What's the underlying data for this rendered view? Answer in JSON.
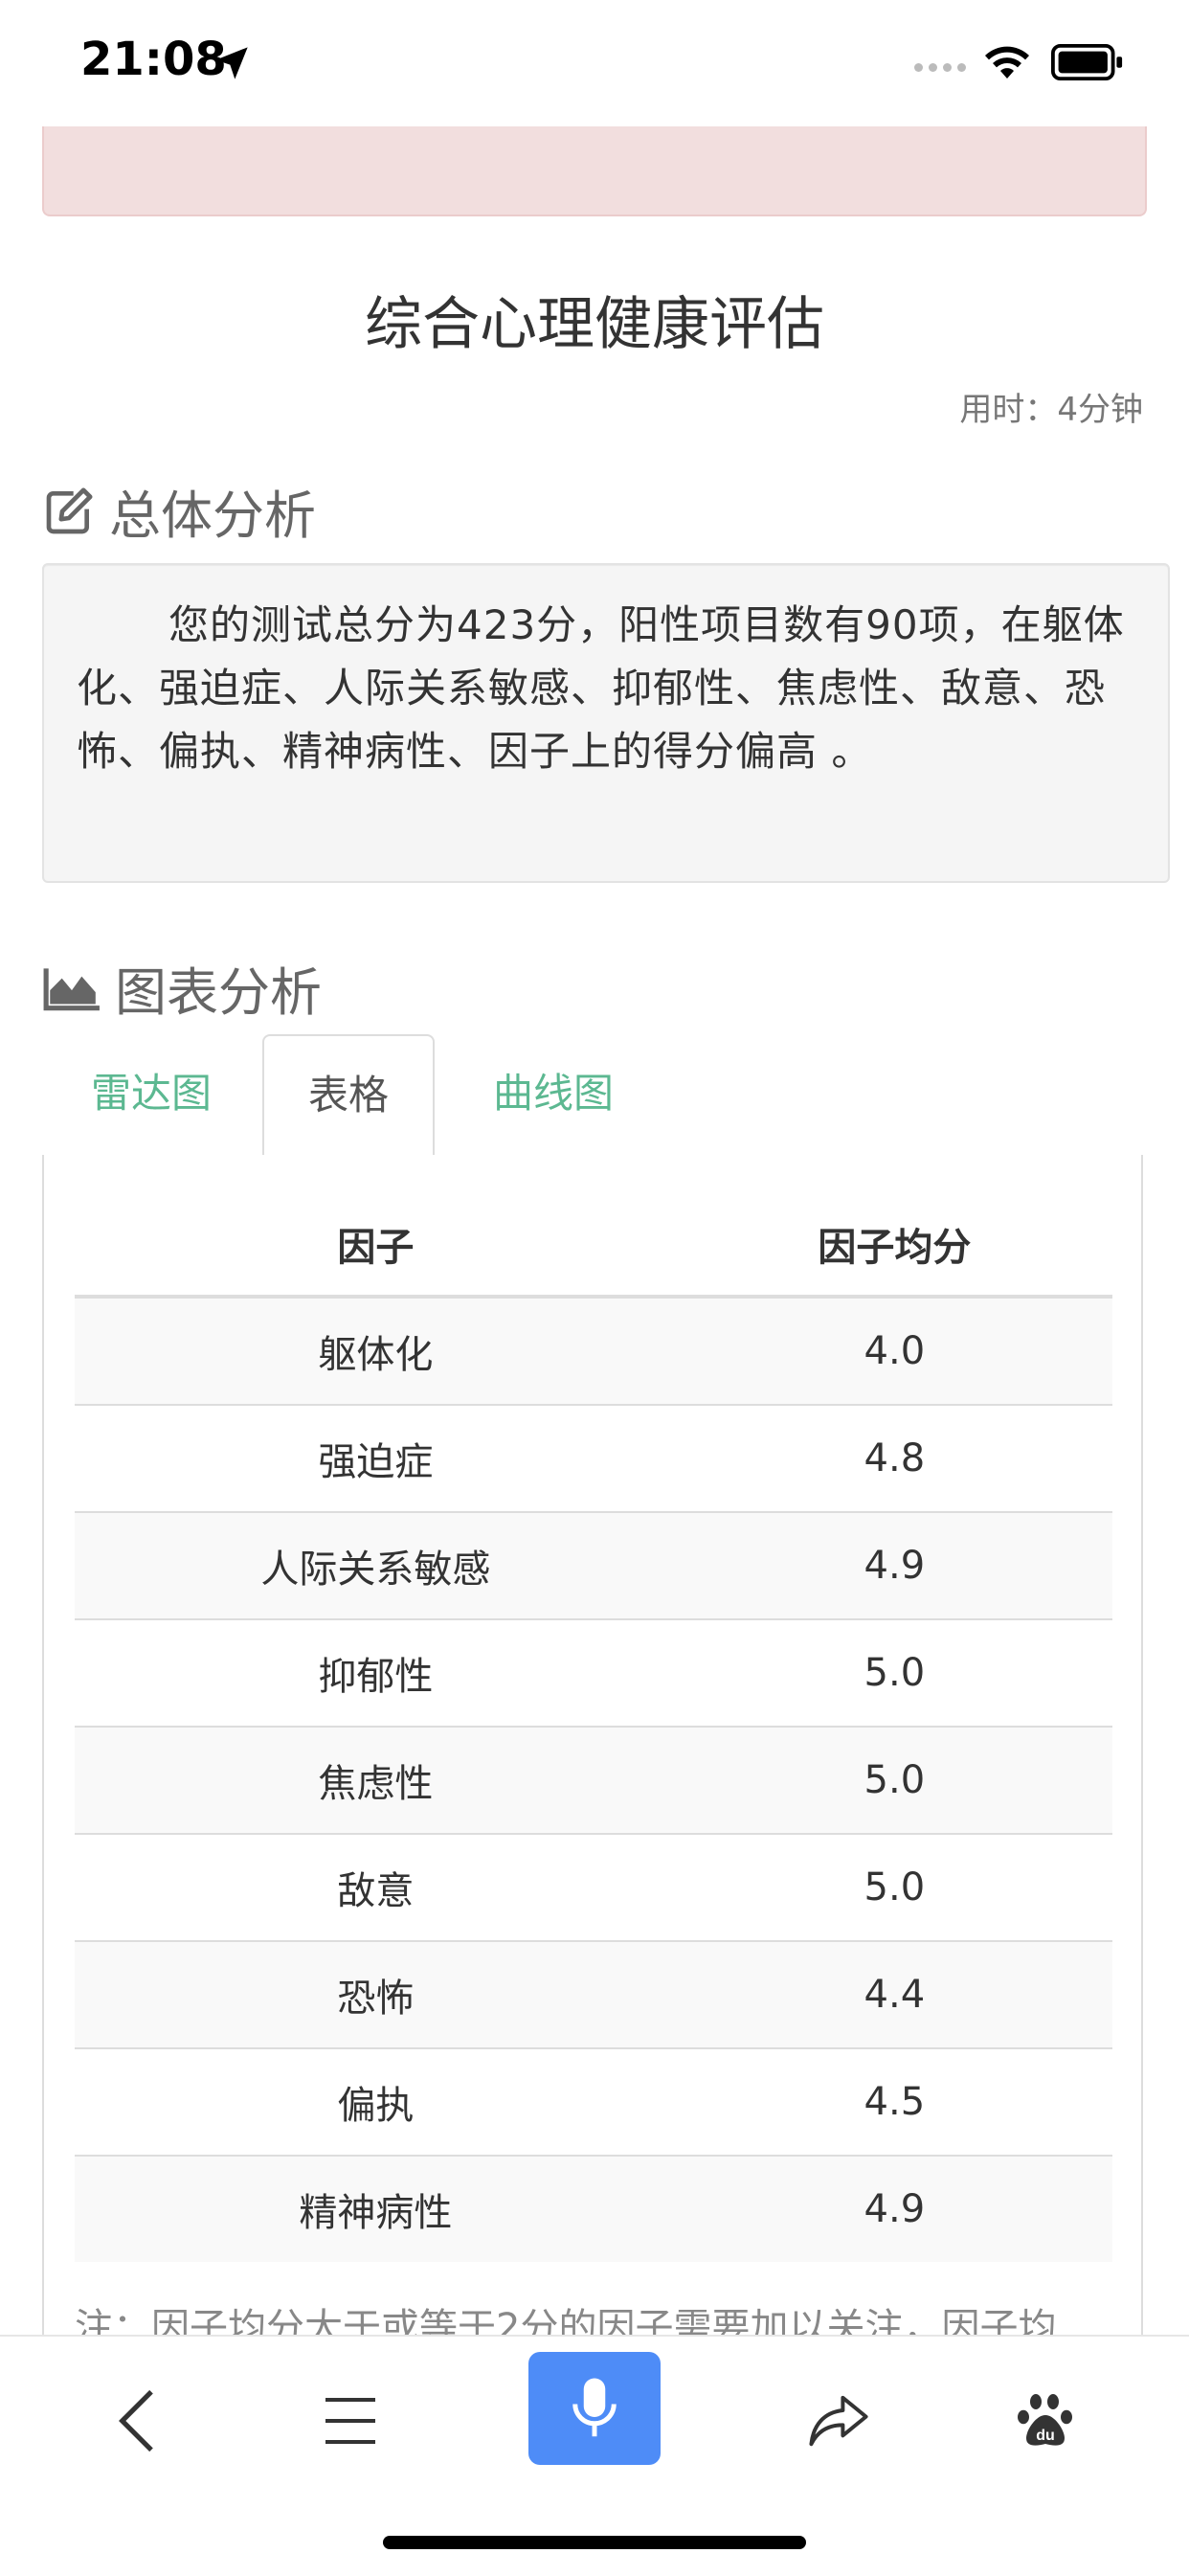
{
  "status_bar": {
    "time": "21:08"
  },
  "page": {
    "title": "综合心理健康评估",
    "duration": "用时：4分钟"
  },
  "overall": {
    "heading": "总体分析",
    "summary": "您的测试总分为423分，阳性项目数有90项，在躯体化、强迫症、人际关系敏感、抑郁性、焦虑性、敌意、恐怖、偏执、精神病性、因子上的得分偏高 。"
  },
  "chart_section": {
    "heading": "图表分析",
    "tabs": [
      {
        "label": "雷达图",
        "active": false
      },
      {
        "label": "表格",
        "active": true
      },
      {
        "label": "曲线图",
        "active": false
      }
    ]
  },
  "table": {
    "headers": [
      "因子",
      "因子均分"
    ],
    "rows": [
      {
        "factor": "躯体化",
        "score": "4.0"
      },
      {
        "factor": "强迫症",
        "score": "4.8"
      },
      {
        "factor": "人际关系敏感",
        "score": "4.9"
      },
      {
        "factor": "抑郁性",
        "score": "5.0"
      },
      {
        "factor": "焦虑性",
        "score": "5.0"
      },
      {
        "factor": "敌意",
        "score": "5.0"
      },
      {
        "factor": "恐怖",
        "score": "4.4"
      },
      {
        "factor": "偏执",
        "score": "4.5"
      },
      {
        "factor": "精神病性",
        "score": "4.9"
      }
    ]
  },
  "note": "注：因子均分大于或等于2分的因子需要加以关注，因子均",
  "bottom_nav": {
    "icons": [
      "back-icon",
      "menu-icon",
      "microphone-icon",
      "share-icon",
      "baidu-paw-icon"
    ],
    "accent": "#4e8cf7"
  },
  "colors": {
    "tab_link": "#5cb891",
    "alert_bg": "#f2dede"
  }
}
